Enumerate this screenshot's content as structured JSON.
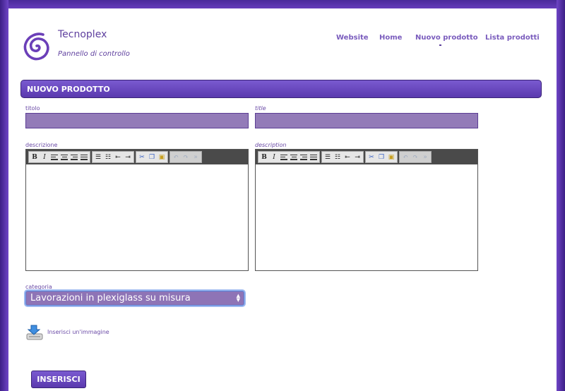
{
  "brand": {
    "title": "Tecnoplex",
    "subtitle": "Pannello di controllo",
    "accent": "#6a3fc0"
  },
  "nav": {
    "items": [
      {
        "label": "Website"
      },
      {
        "label": "Home"
      },
      {
        "label": "Nuovo prodotto"
      },
      {
        "label": "Lista prodotti"
      }
    ]
  },
  "section": {
    "title": "NUOVO PRODOTTO"
  },
  "form": {
    "titolo_label": "titolo",
    "title_label": "title",
    "titolo_value": "",
    "title_value": "",
    "descrizione_label": "descrizione",
    "description_label": "description",
    "categoria_label": "categoria",
    "categoria_value": "Lavorazioni in plexiglass su misura",
    "image_link": "Inserisci un'immagine",
    "submit_label": "INSERISCI"
  },
  "toolbar_icons": [
    "bold-icon",
    "italic-icon",
    "align-left-icon",
    "align-center-icon",
    "align-right-icon",
    "justify-icon",
    "bullet-list-icon",
    "numbered-list-icon",
    "outdent-icon",
    "indent-icon",
    "cut-icon",
    "copy-icon",
    "paste-icon",
    "undo-icon",
    "redo-icon",
    "clear-icon"
  ]
}
